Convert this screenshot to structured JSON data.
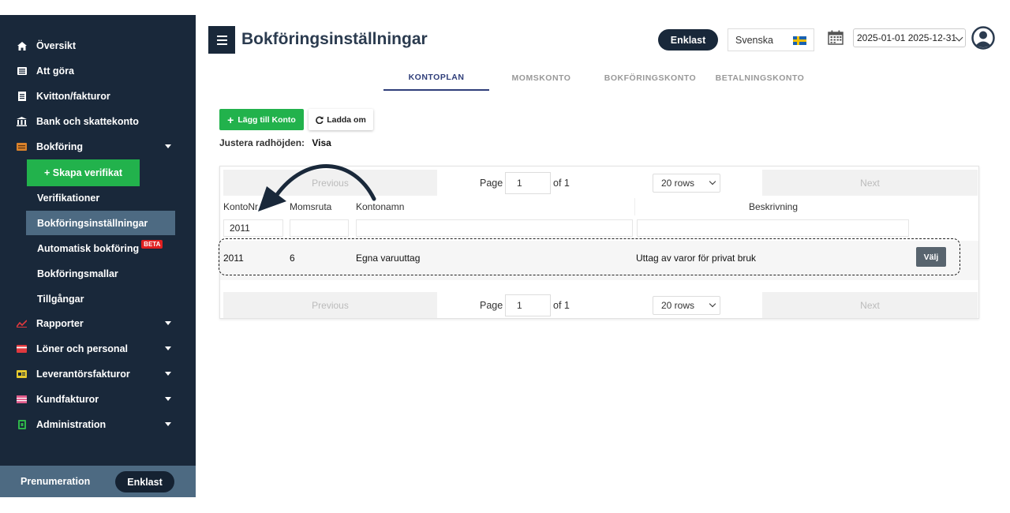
{
  "sidebar": {
    "items": [
      {
        "label": "Översikt",
        "icon": "home-icon"
      },
      {
        "label": "Att göra",
        "icon": "list-icon"
      },
      {
        "label": "Kvitton/fakturor",
        "icon": "document-icon"
      },
      {
        "label": "Bank och skattekonto",
        "icon": "bank-icon"
      },
      {
        "label": "Bokföring",
        "icon": "ledger-icon"
      },
      {
        "label": "Rapporter",
        "icon": "chart-icon"
      },
      {
        "label": "Löner och personal",
        "icon": "card-icon"
      },
      {
        "label": "Leverantörsfakturor",
        "icon": "invoice-icon"
      },
      {
        "label": "Kundfakturor",
        "icon": "flag-icon"
      },
      {
        "label": "Administration",
        "icon": "admin-icon"
      }
    ],
    "create_button": "+ Skapa verifikat",
    "sub_items": [
      {
        "label": "Verifikationer"
      },
      {
        "label": "Bokföringsinställningar"
      },
      {
        "label": "Automatisk bokföring"
      },
      {
        "label": "Bokföringsmallar"
      },
      {
        "label": "Tillgångar"
      }
    ],
    "beta_badge": "BETA",
    "subscription": {
      "label": "Prenumeration",
      "plan": "Enklast"
    }
  },
  "header": {
    "title": "Bokföringsinställningar",
    "plan": "Enklast",
    "language": "Svenska",
    "date_range": "2025-01-01 2025-12-31"
  },
  "tabs": [
    {
      "label": "KONTOPLAN",
      "active": true
    },
    {
      "label": "MOMSKONTO",
      "active": false
    },
    {
      "label": "BOKFÖRINGSKONTO",
      "active": false
    },
    {
      "label": "BETALNINGSKONTO",
      "active": false
    }
  ],
  "actions": {
    "add": "Lägg till Konto",
    "reload": "Ladda om",
    "row_height_label": "Justera radhöjden:",
    "row_height_value": "Visa"
  },
  "table": {
    "pager": {
      "previous": "Previous",
      "next": "Next",
      "page_label": "Page",
      "page": "1",
      "of_label": "of 1",
      "rows": "20 rows"
    },
    "columns": [
      "KontoNr",
      "Momsruta",
      "Kontonamn",
      "Beskrivning"
    ],
    "filter": {
      "kontonr": "2011"
    },
    "rows": [
      {
        "kontonr": "2011",
        "momsruta": "6",
        "kontonamn": "Egna varuuttag",
        "beskrivning": "Uttag av varor för privat bruk",
        "action": "Välj"
      }
    ]
  }
}
